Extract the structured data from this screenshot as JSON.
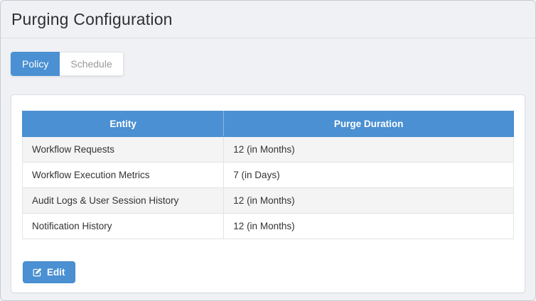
{
  "page": {
    "title": "Purging Configuration"
  },
  "tabs": [
    {
      "label": "Policy",
      "active": true
    },
    {
      "label": "Schedule",
      "active": false
    }
  ],
  "table": {
    "columns": [
      "Entity",
      "Purge Duration"
    ],
    "rows": [
      {
        "entity": "Workflow Requests",
        "purge_duration": "12 (in Months)"
      },
      {
        "entity": "Workflow Execution Metrics",
        "purge_duration": "7 (in Days)"
      },
      {
        "entity": "Audit Logs & User Session History",
        "purge_duration": "12 (in Months)"
      },
      {
        "entity": "Notification History",
        "purge_duration": "12 (in Months)"
      }
    ]
  },
  "actions": {
    "edit_label": "Edit"
  },
  "colors": {
    "accent_blue": "#4a90d2",
    "page_background": "#eff1f5",
    "card_background": "#ffffff",
    "row_alternate": "#f4f4f5",
    "border": "#d9dde2",
    "inactive_tab_text": "#97999c",
    "body_text": "#333333",
    "header_text": "#ffffff"
  }
}
